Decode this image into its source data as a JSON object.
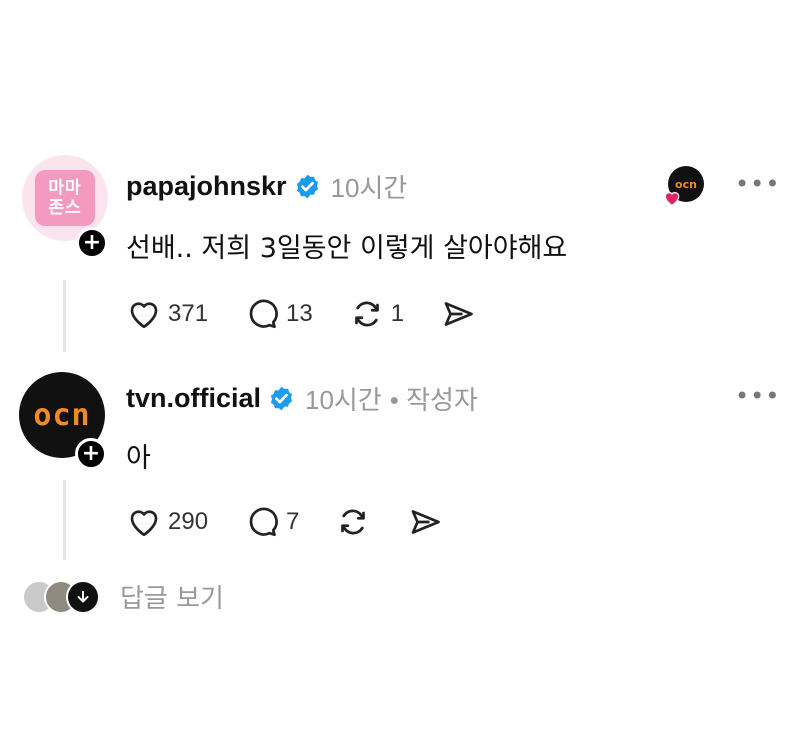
{
  "posts": [
    {
      "avatar_text": "마마존스",
      "username": "papajohnskr",
      "time": "10시간",
      "author_tag": "",
      "content": "선배.. 저희 3일동안 이렇게 살아야해요",
      "likes": "371",
      "comments": "13",
      "reposts": "1",
      "liked_by_author_badge": "ocn"
    },
    {
      "avatar_text": "ocn",
      "username": "tvn.official",
      "time": "10시간",
      "author_tag": "• 작성자",
      "content": "아",
      "likes": "290",
      "comments": "7",
      "reposts": ""
    }
  ],
  "more_label": "•••",
  "plus_label": "+",
  "view_replies": "답글 보기",
  "colors": {
    "verified": "#1d9bf0",
    "heart": "#e0245e",
    "mama_bg": "#f7a6c6",
    "ocn_orange": "#f08a24"
  }
}
